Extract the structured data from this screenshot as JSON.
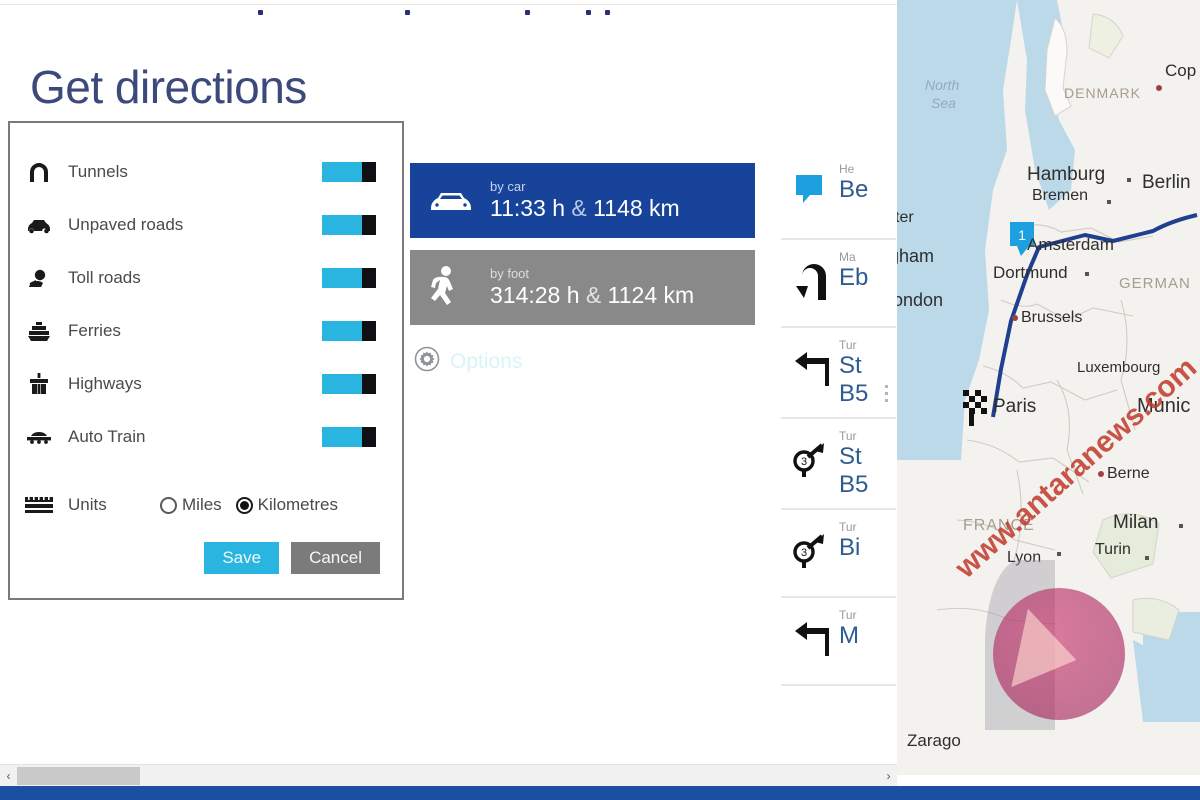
{
  "page": {
    "title": "Get directions"
  },
  "options_dialog": {
    "rows": [
      {
        "icon": "tunnel-icon",
        "label": "Tunnels",
        "toggle": "on"
      },
      {
        "icon": "car-icon",
        "label": "Unpaved roads",
        "toggle": "on"
      },
      {
        "icon": "toll-icon",
        "label": "Toll roads",
        "toggle": "on"
      },
      {
        "icon": "ferry-icon",
        "label": "Ferries",
        "toggle": "on"
      },
      {
        "icon": "highway-icon",
        "label": "Highways",
        "toggle": "on"
      },
      {
        "icon": "auto-train-icon",
        "label": "Auto Train",
        "toggle": "on"
      }
    ],
    "units": {
      "icon": "ruler-icon",
      "label": "Units",
      "options": [
        "Miles",
        "Kilometres"
      ],
      "selected": "Kilometres"
    },
    "buttons": {
      "save": "Save",
      "cancel": "Cancel"
    },
    "colors": {
      "toggle_on": "#29b5e0",
      "save": "#29b5e0",
      "cancel": "#7b7b7b",
      "border": "#7a7a7a"
    }
  },
  "travel_modes": [
    {
      "icon": "car-icon",
      "mode": "by car",
      "duration": "11:33 h",
      "separator": "&",
      "distance": "1148 km",
      "selected": true,
      "color": "#17449a"
    },
    {
      "icon": "pedestrian-icon",
      "mode": "by foot",
      "duration": "314:28 h",
      "separator": "&",
      "distance": "1124 km",
      "selected": false,
      "color": "#898989"
    }
  ],
  "options_link": {
    "icon": "gear-icon",
    "label": "Options"
  },
  "directions": [
    {
      "icon": "start-flag-icon",
      "kind": "He",
      "street": "Be",
      "street2": ""
    },
    {
      "icon": "uturn-icon",
      "kind": "Ma",
      "street": "Eb",
      "street2": ""
    },
    {
      "icon": "turn-left-icon",
      "kind": "Tur",
      "street": "St",
      "street2": "B5"
    },
    {
      "icon": "roundabout-3-icon",
      "kind": "Tur",
      "street": "St",
      "street2": "B5"
    },
    {
      "icon": "roundabout-3-icon",
      "kind": "Tur",
      "street": "Bi",
      "street2": ""
    },
    {
      "icon": "turn-left-icon",
      "kind": "Tur",
      "street": "M",
      "street2": ""
    }
  ],
  "map": {
    "seas": [
      "North Sea"
    ],
    "countries": [
      "DENMARK",
      "GERMANY",
      "FRANCE"
    ],
    "cities": [
      "Copenhagen",
      "Hamburg",
      "Bremen",
      "Berlin",
      "Amsterdam",
      "Dortmund",
      "Brussels",
      "Luxembourg",
      "Paris",
      "Munich",
      "Berne",
      "Milan",
      "Turin",
      "Lyon",
      "Zaragoza",
      "London",
      "Birmingham",
      "Manchester"
    ],
    "waypoint_marker": "1",
    "destination_marker": "checkered-flag",
    "watermark": "www.antaranews.com"
  },
  "scrollbar": {
    "left_arrow": "‹",
    "right_arrow": "›"
  }
}
